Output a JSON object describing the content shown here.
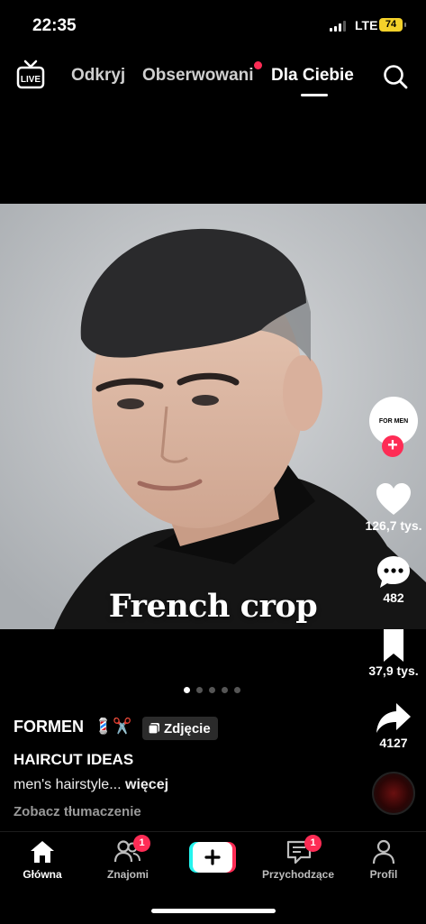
{
  "status_bar": {
    "time": "22:35",
    "network": "LTE",
    "battery": "74"
  },
  "top_nav": {
    "live_label": "LIVE",
    "tabs": [
      {
        "label": "Odkryj",
        "active": false
      },
      {
        "label": "Obserwowani",
        "active": false,
        "has_dot": true
      },
      {
        "label": "Dla Ciebie",
        "active": true
      }
    ]
  },
  "post": {
    "caption": "French crop",
    "slide_count": 5,
    "active_slide": 1,
    "username": "FORMEN",
    "username_emoji": "💈✂️",
    "type_badge": "Zdjęcie",
    "title": "HAIRCUT IDEAS",
    "description": "men's hairstyle...",
    "more_label": "więcej",
    "translate_label": "Zobacz tłumaczenie"
  },
  "right_rail": {
    "avatar_text": "FOR MEN",
    "likes": "126,7 tys.",
    "comments": "482",
    "saves": "37,9 tys.",
    "shares": "4127"
  },
  "bottom_nav": {
    "items": [
      {
        "label": "Główna",
        "active": true
      },
      {
        "label": "Znajomi",
        "badge": "1"
      },
      {
        "label": ""
      },
      {
        "label": "Przychodzące",
        "badge": "1"
      },
      {
        "label": "Profil"
      }
    ]
  },
  "colors": {
    "accent": "#fe2c55",
    "battery": "#f4d12a",
    "background": "#000000"
  }
}
